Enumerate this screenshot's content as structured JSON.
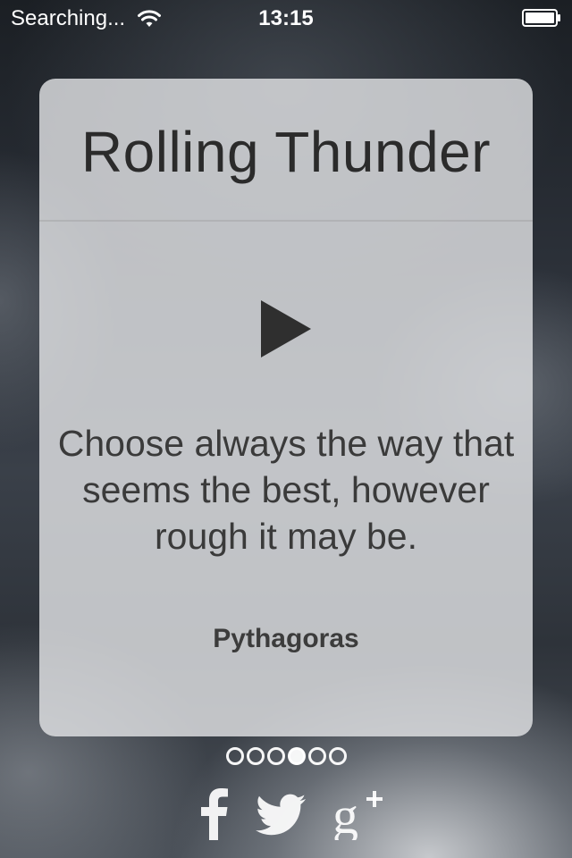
{
  "status_bar": {
    "carrier": "Searching...",
    "time": "13:15",
    "icons": [
      "wifi-icon",
      "battery-icon"
    ]
  },
  "card": {
    "title": "Rolling Thunder",
    "play_icon": "play-icon",
    "quote": "Choose always the way that seems the best, however rough it may be.",
    "author": "Pythagoras"
  },
  "pagination": {
    "total": 6,
    "active_index": 3
  },
  "social": {
    "icons": [
      "facebook-icon",
      "twitter-icon",
      "google-plus-icon"
    ]
  },
  "colors": {
    "card_background": "#e1e2e4",
    "text": "#2b2b2b",
    "status_text": "#ffffff"
  }
}
